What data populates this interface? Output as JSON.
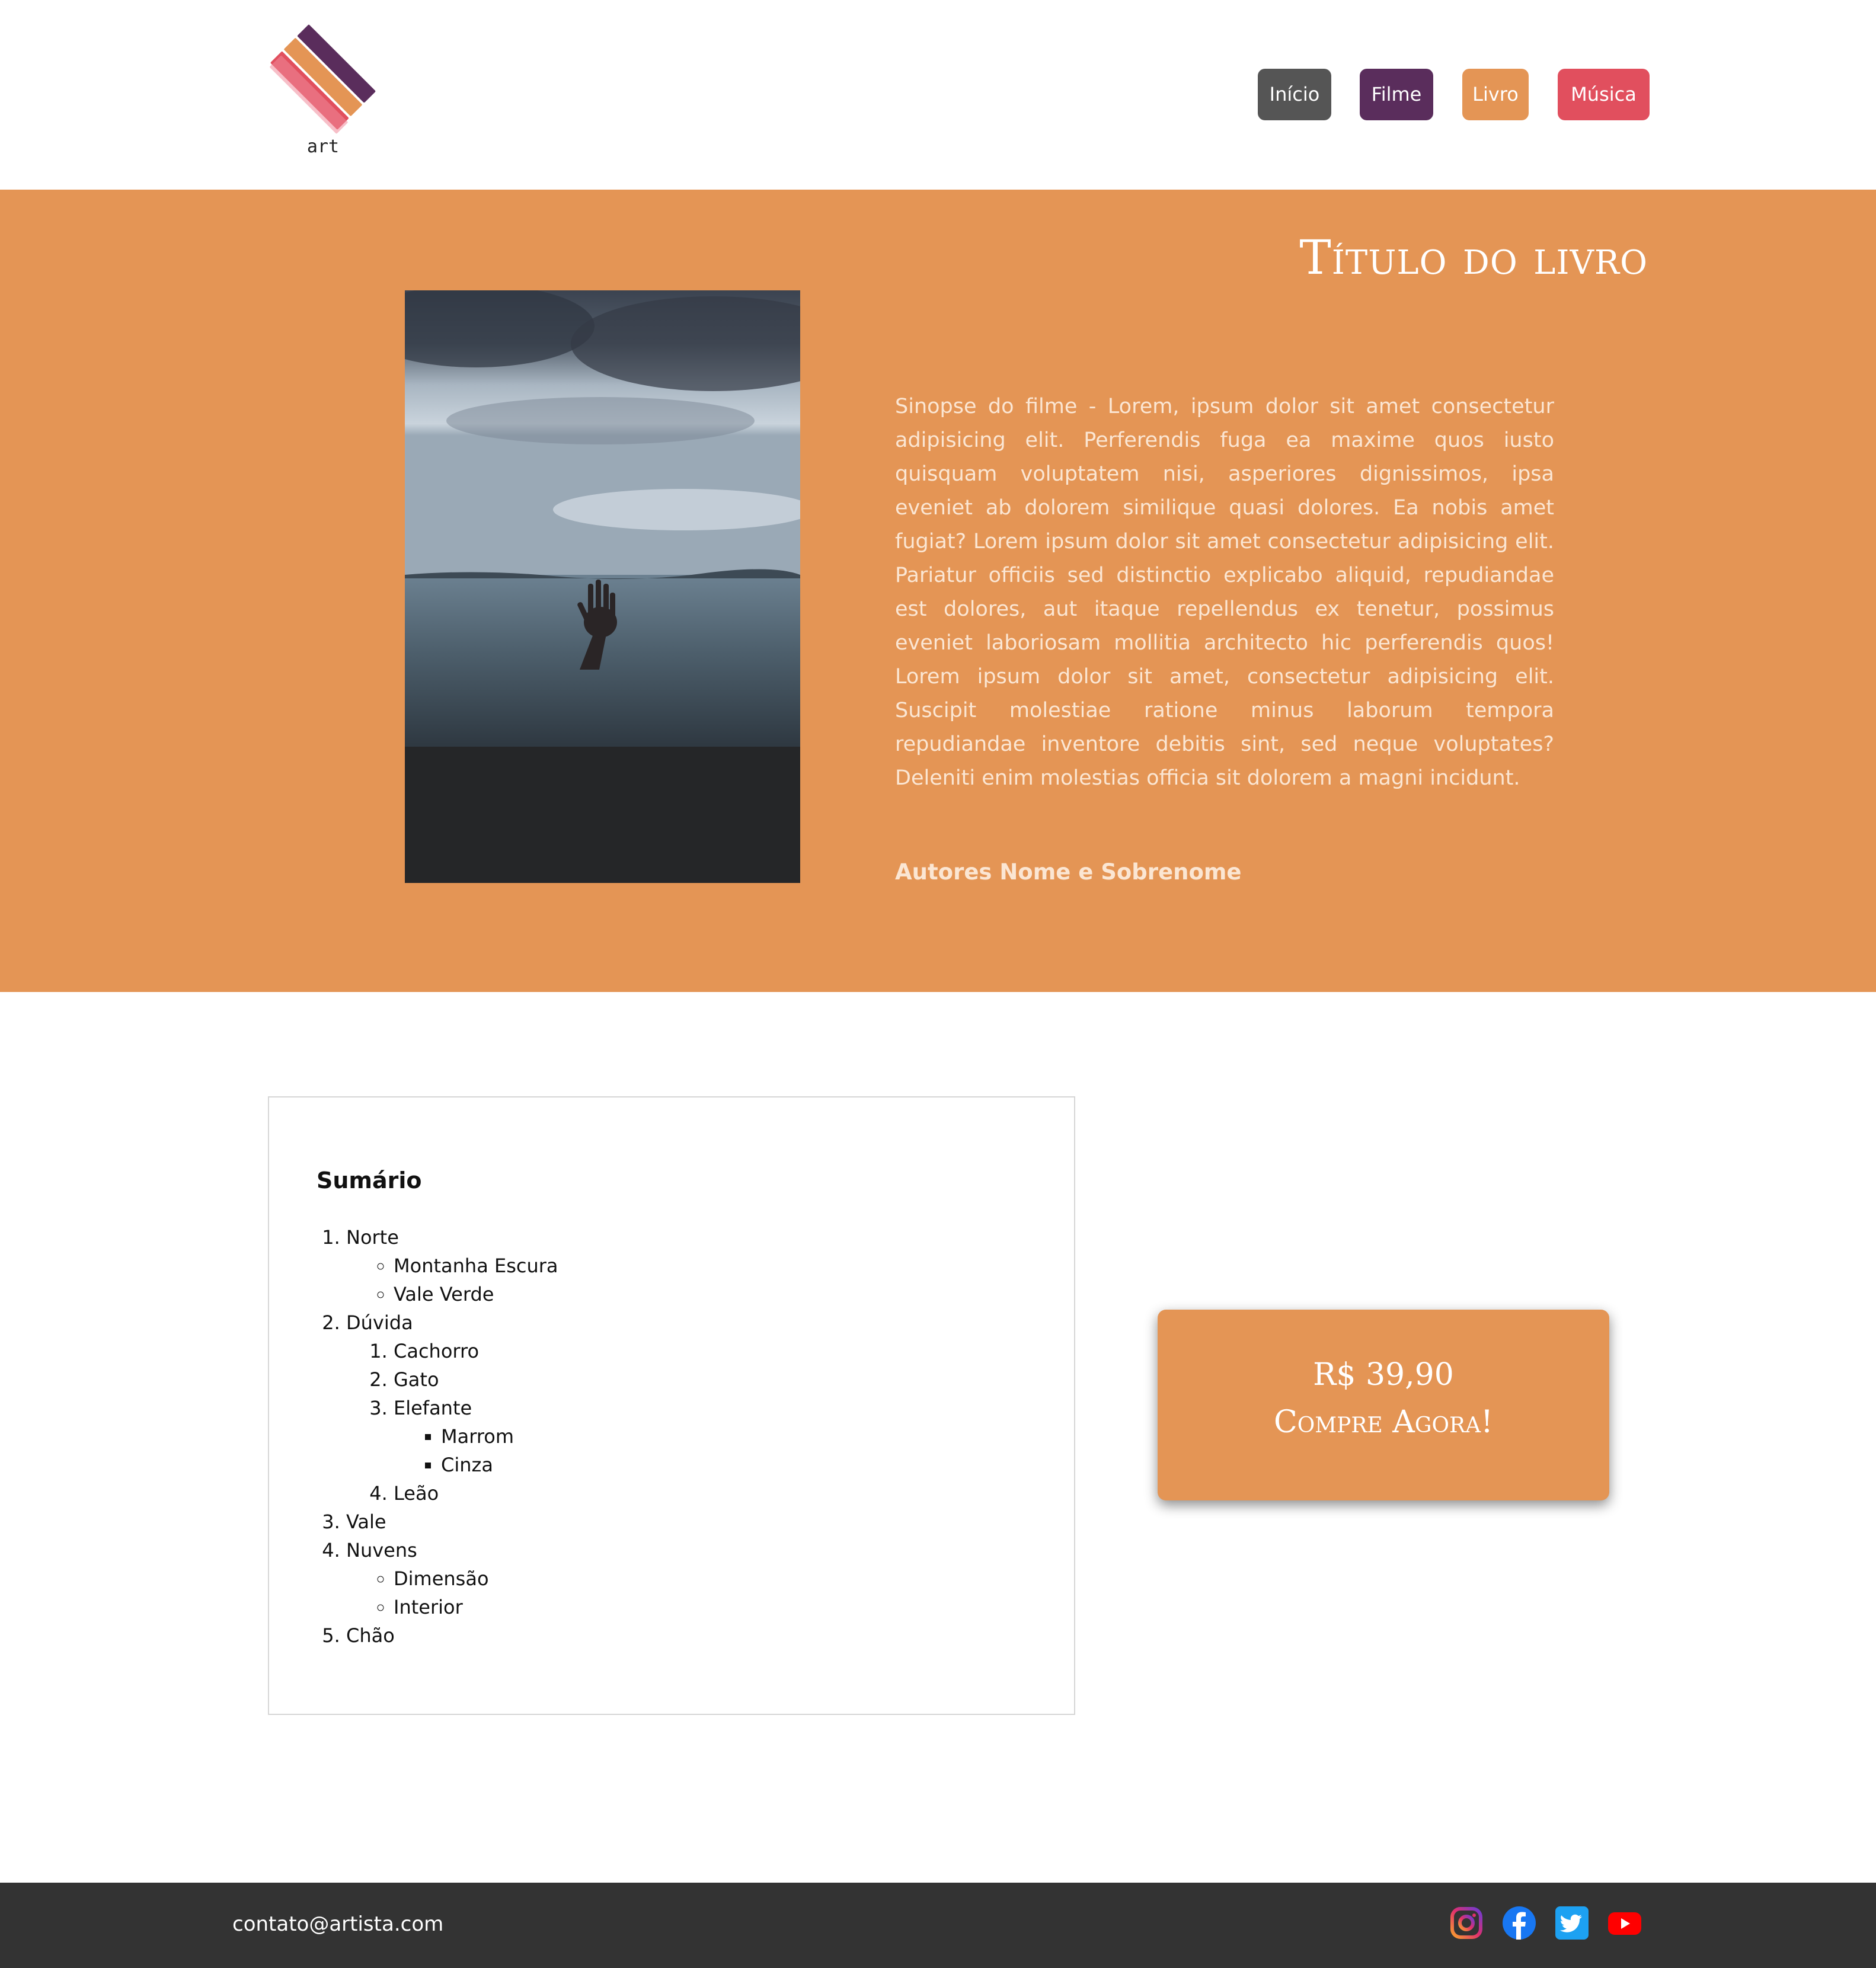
{
  "header": {
    "logo_text": "art",
    "nav": [
      {
        "label": "Início",
        "color": "#555555"
      },
      {
        "label": "Filme",
        "color": "#5a2d5c"
      },
      {
        "label": "Livro",
        "color": "#e49555"
      },
      {
        "label": "Música",
        "color": "#e14f5e"
      }
    ]
  },
  "hero": {
    "title": "Título do livro",
    "synopsis": "Sinopse do filme - Lorem, ipsum dolor sit amet consectetur adipisicing elit. Perferendis fuga ea maxime quos iusto quisquam voluptatem nisi, asperiores dignissimos, ipsa eveniet ab dolorem similique quasi dolores. Ea nobis amet fugiat? Lorem ipsum dolor sit amet consectetur adipisicing elit. Pariatur officiis sed distinctio explicabo aliquid, repudiandae est dolores, aut itaque repellendus ex tenetur, possimus eveniet laboriosam mollitia architecto hic perferendis quos! Lorem ipsum dolor sit amet, consectetur adipisicing elit. Suscipit molestiae ratione minus laborum tempora repudiandae inventore debitis sint, sed neque voluptates? Deleniti enim molestias officia sit dolorem a magni incidunt.",
    "authors": "Autores Nome e Sobrenome",
    "background_color": "#e49555"
  },
  "summary": {
    "title": "Sumário",
    "items": {
      "norte": "Norte",
      "montanha": "Montanha Escura",
      "vale_verde": "Vale Verde",
      "duvida": "Dúvida",
      "cachorro": "Cachorro",
      "gato": "Gato",
      "elefante": "Elefante",
      "marrom": "Marrom",
      "cinza": "Cinza",
      "leao": "Leão",
      "vale": "Vale",
      "nuvens": "Nuvens",
      "dimensao": "Dimensão",
      "interior": "Interior",
      "chao": "Chão"
    }
  },
  "buy": {
    "price": "R$ 39,90",
    "cta": "Compre Agora!"
  },
  "footer": {
    "email": "contato@artista.com",
    "social": [
      "instagram-icon",
      "facebook-icon",
      "twitter-icon",
      "youtube-icon"
    ]
  }
}
